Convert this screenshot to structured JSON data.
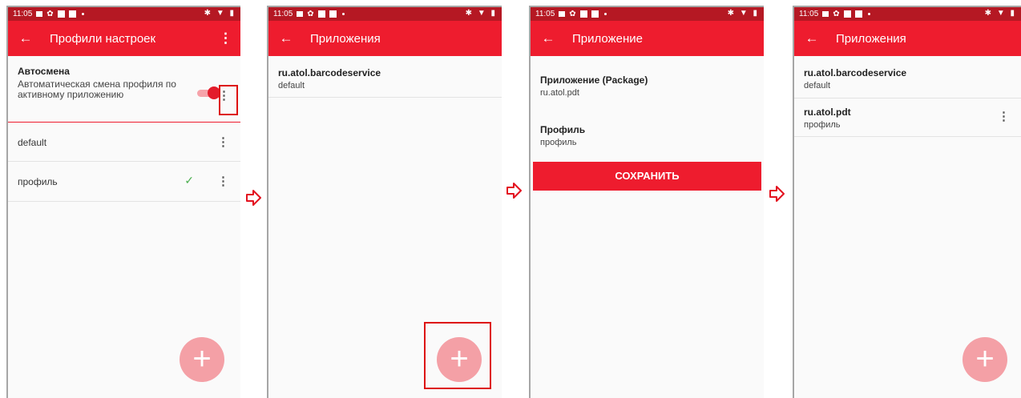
{
  "status": {
    "time": "11:05",
    "right": "✱ ▼ ▮"
  },
  "screen1": {
    "title": "Профили настроек",
    "autoswitch_title": "Автосмена",
    "autoswitch_desc": "Автоматическая смена профиля по активному приложению",
    "profiles": [
      {
        "name": "default"
      },
      {
        "name": "профиль",
        "check": "✓"
      }
    ]
  },
  "screen2": {
    "title": "Приложения",
    "items": [
      {
        "package": "ru.atol.barcodeservice",
        "profile": "default"
      }
    ]
  },
  "screen3": {
    "title": "Приложение",
    "field1_label": "Приложение (Package)",
    "field1_value": "ru.atol.pdt",
    "field2_label": "Профиль",
    "field2_value": "профиль",
    "save_label": "СОХРАНИТЬ"
  },
  "screen4": {
    "title": "Приложения",
    "items": [
      {
        "package": "ru.atol.barcodeservice",
        "profile": "default"
      },
      {
        "package": "ru.atol.pdt",
        "profile": "профиль"
      }
    ]
  },
  "icons": {
    "back": "←",
    "kebab": "⋮",
    "plus": "+"
  },
  "colors": {
    "appbar": "#ee1c2e",
    "statusbar": "#b51823",
    "fab": "#f4a0a6",
    "check": "#4caf50",
    "highlight": "#d11111"
  }
}
